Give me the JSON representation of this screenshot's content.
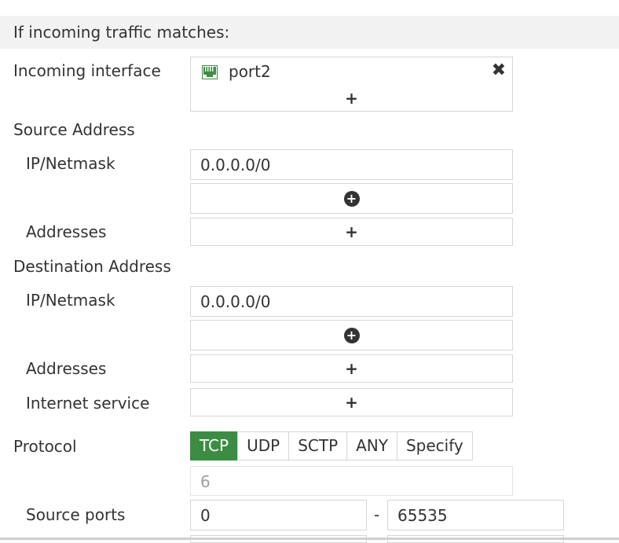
{
  "section_header": "If incoming traffic matches:",
  "incoming_interface": {
    "label": "Incoming interface",
    "entries": [
      {
        "name": "port2"
      }
    ],
    "remove_symbol": "✖",
    "add_symbol": "+"
  },
  "source_address": {
    "label": "Source Address",
    "ipnetmask_label": "IP/Netmask",
    "ipnetmask_value": "0.0.0.0/0",
    "addresses_label": "Addresses",
    "add_symbol": "+"
  },
  "destination_address": {
    "label": "Destination Address",
    "ipnetmask_label": "IP/Netmask",
    "ipnetmask_value": "0.0.0.0/0",
    "addresses_label": "Addresses",
    "internet_service_label": "Internet service",
    "add_symbol": "+"
  },
  "protocol": {
    "label": "Protocol",
    "options": [
      "TCP",
      "UDP",
      "SCTP",
      "ANY",
      "Specify"
    ],
    "selected": "TCP",
    "number": "6"
  },
  "source_ports": {
    "label": "Source ports",
    "from": "0",
    "separator": "-",
    "to": "65535"
  },
  "colors": {
    "active_accent": "#3c8d43",
    "header_bg": "#f2f2f2"
  },
  "icons": {
    "interface": "ethernet-port-icon",
    "remove": "close-icon",
    "add": "plus-icon",
    "add_circle": "plus-circle-icon"
  }
}
